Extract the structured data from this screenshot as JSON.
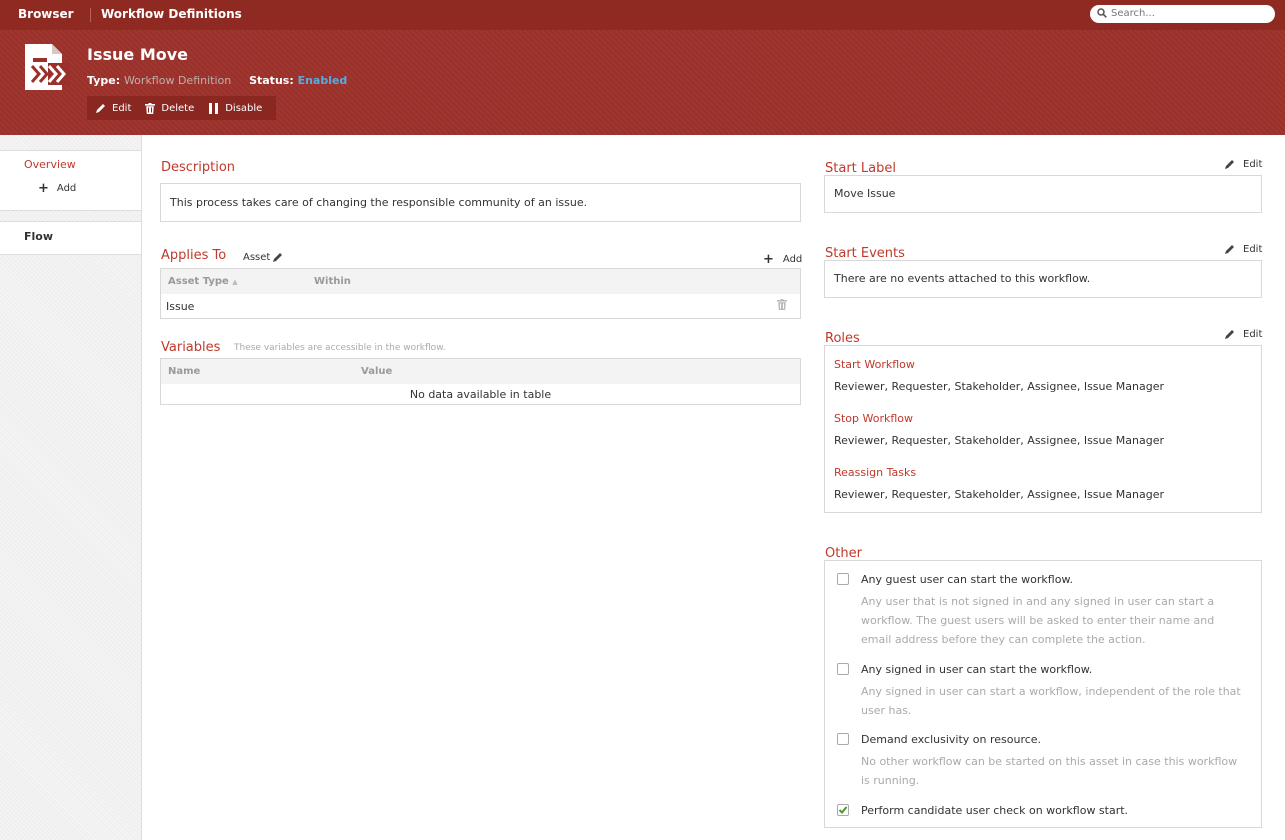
{
  "topbar": {
    "brand": "Browser",
    "breadcrumb": "Workflow Definitions",
    "search_placeholder": "Search..."
  },
  "header": {
    "title": "Issue Move",
    "type_label": "Type:",
    "type_value": "Workflow Definition",
    "status_label": "Status:",
    "status_value": "Enabled",
    "actions": {
      "edit": "Edit",
      "delete": "Delete",
      "disable": "Disable"
    }
  },
  "sidebar": {
    "overview": "Overview",
    "add": "Add",
    "flow": "Flow"
  },
  "description": {
    "title": "Description",
    "text": "This process takes care of changing the responsible community of an issue."
  },
  "applies_to": {
    "title": "Applies To",
    "asset_label": "Asset",
    "add": "Add",
    "columns": [
      "Asset Type",
      "Within"
    ],
    "rows": [
      [
        "Issue",
        ""
      ]
    ]
  },
  "variables": {
    "title": "Variables",
    "hint": "These variables are accessible in the workflow.",
    "columns": [
      "Name",
      "Value"
    ],
    "empty": "No data available in table"
  },
  "start_label": {
    "title": "Start Label",
    "edit": "Edit",
    "value": "Move Issue"
  },
  "start_events": {
    "title": "Start Events",
    "edit": "Edit",
    "value": "There are no events attached to this workflow."
  },
  "roles": {
    "title": "Roles",
    "edit": "Edit",
    "items": [
      {
        "name": "Start Workflow",
        "list": "Reviewer, Requester, Stakeholder, Assignee, Issue Manager"
      },
      {
        "name": "Stop Workflow",
        "list": "Reviewer, Requester, Stakeholder, Assignee, Issue Manager"
      },
      {
        "name": "Reassign Tasks",
        "list": "Reviewer, Requester, Stakeholder, Assignee, Issue Manager"
      }
    ]
  },
  "other": {
    "title": "Other",
    "options": [
      {
        "label": "Any guest user can start the workflow.",
        "checked": false,
        "desc": "Any user that is not signed in and any signed in user can start a workflow. The guest users will be asked to enter their name and email address before they can complete the action."
      },
      {
        "label": "Any signed in user can start the workflow.",
        "checked": false,
        "desc": "Any signed in user can start a workflow, independent of the role that user has."
      },
      {
        "label": "Demand exclusivity on resource.",
        "checked": false,
        "desc": "No other workflow can be started on this asset in case this workflow is running."
      },
      {
        "label": "Perform candidate user check on workflow start.",
        "checked": true,
        "desc": ""
      }
    ]
  }
}
